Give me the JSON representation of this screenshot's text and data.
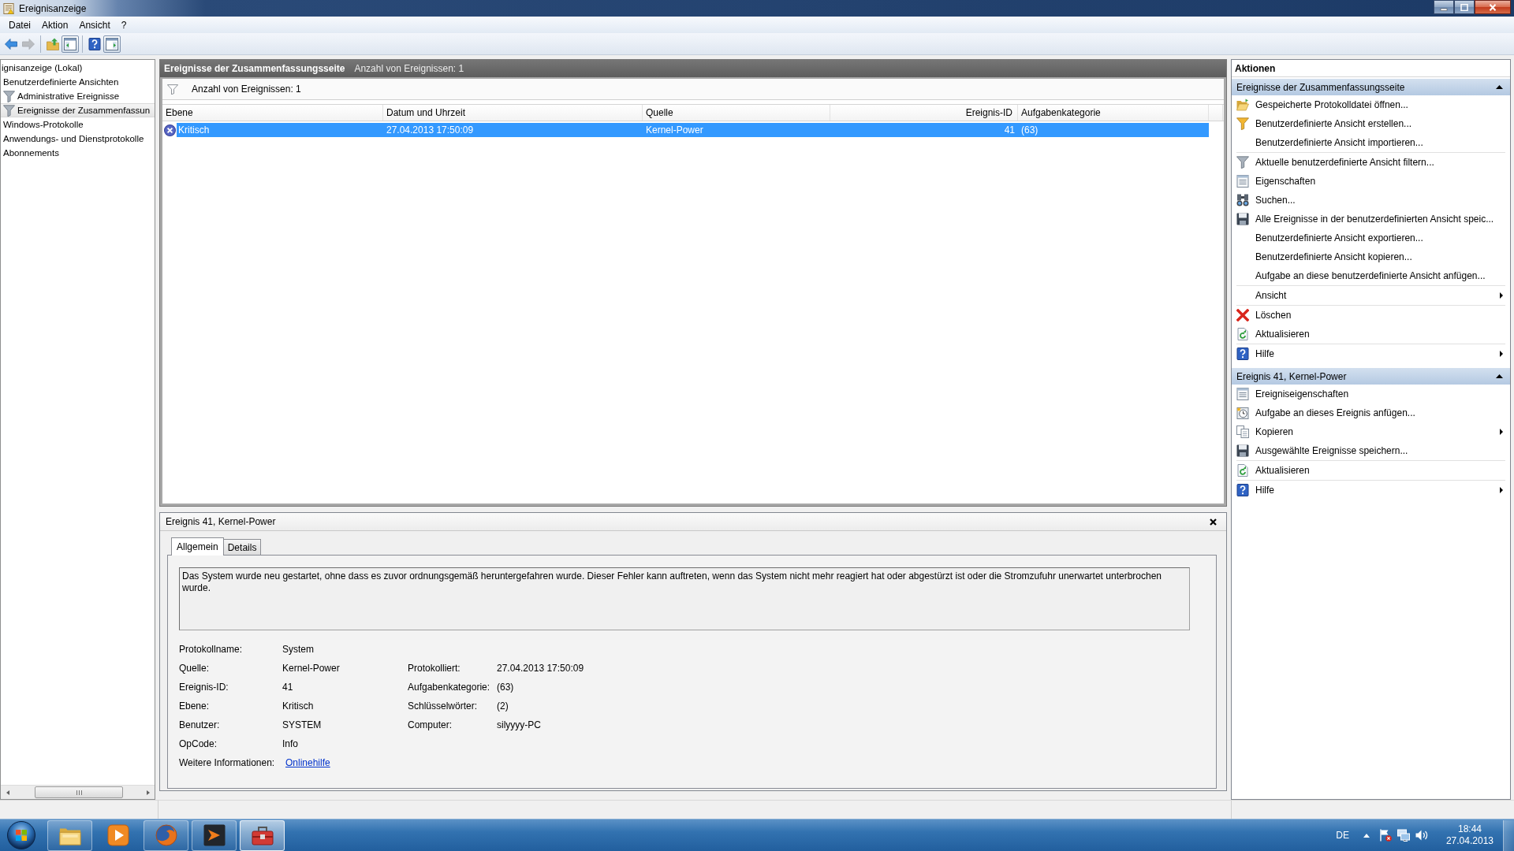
{
  "window": {
    "title": "Ereignisanzeige"
  },
  "menu": [
    "Datei",
    "Aktion",
    "Ansicht",
    "?"
  ],
  "toolbar": [
    [
      {
        "kind": "back",
        "disabled": false,
        "pressed": false
      },
      {
        "kind": "forward",
        "disabled": true,
        "pressed": false
      }
    ],
    [
      {
        "kind": "up",
        "disabled": false,
        "pressed": false
      },
      {
        "kind": "tree",
        "disabled": false,
        "pressed": true
      }
    ],
    [
      {
        "kind": "help",
        "disabled": false,
        "pressed": false
      },
      {
        "kind": "actions",
        "disabled": false,
        "pressed": true
      }
    ]
  ],
  "tree": {
    "items": [
      {
        "label": "ignisanzeige (Lokal)",
        "selected": false,
        "children": [
          {
            "label": "Benutzerdefinierte Ansichten",
            "selected": false,
            "children": [
              {
                "label": "Administrative Ereignisse",
                "selected": false
              },
              {
                "label": "Ereignisse der Zusammenfassun",
                "selected": true
              }
            ]
          },
          {
            "label": "Windows-Protokolle",
            "selected": false
          },
          {
            "label": "Anwendungs- und Dienstprotokolle",
            "selected": false
          },
          {
            "label": "Abonnements",
            "selected": false
          }
        ]
      }
    ]
  },
  "summary": {
    "title": "Ereignisse der Zusammenfassungsseite",
    "count": "Anzahl von Ereignissen: 1"
  },
  "filter_bar": {
    "text": "Anzahl von Ereignissen: 1"
  },
  "table": {
    "columns": [
      {
        "label": "Ebene",
        "kind": "text"
      },
      {
        "label": "Datum und Uhrzeit",
        "kind": "text"
      },
      {
        "label": "Quelle",
        "kind": "text"
      },
      {
        "label": "Ereignis-ID",
        "kind": "number"
      },
      {
        "label": "Aufgabenkategorie",
        "kind": "text"
      }
    ],
    "rows": [
      {
        "selected": true,
        "cells": [
          "Kritisch",
          "27.04.2013 17:50:09",
          "Kernel-Power",
          "41",
          "(63)"
        ]
      }
    ]
  },
  "detail": {
    "title": "Ereignis 41, Kernel-Power",
    "tabs": [
      {
        "label": "Allgemein",
        "selected": true
      },
      {
        "label": "Details",
        "selected": false
      }
    ],
    "description": "Das System wurde neu gestartet, ohne dass es zuvor ordnungsgemäß heruntergefahren wurde. Dieser Fehler kann auftreten, wenn das System nicht mehr reagiert hat oder abgestürzt ist oder die Stromzufuhr unerwartet unterbrochen wurde.",
    "fields": [
      [
        {
          "label": "Protokollname:",
          "value": "System"
        }
      ],
      [
        {
          "label": "Quelle:",
          "value": "Kernel-Power"
        },
        {
          "label": "Protokolliert:",
          "value": "27.04.2013 17:50:09"
        }
      ],
      [
        {
          "label": "Ereignis-ID:",
          "value": "41"
        },
        {
          "label": "Aufgabenkategorie:",
          "value": "(63)"
        }
      ],
      [
        {
          "label": "Ebene:",
          "value": "Kritisch"
        },
        {
          "label": "Schlüsselwörter:",
          "value": "(2)"
        }
      ],
      [
        {
          "label": "Benutzer:",
          "value": "SYSTEM"
        },
        {
          "label": "Computer:",
          "value": "silyyyy-PC"
        }
      ],
      [
        {
          "label": "OpCode:",
          "value": "Info"
        }
      ],
      [
        {
          "label": "Weitere Informationen:",
          "link": "Onlinehilfe"
        }
      ]
    ]
  },
  "actions": {
    "title": "Aktionen",
    "sections": [
      {
        "title": "Ereignisse der Zusammenfassungsseite",
        "expanded": true,
        "groups": [
          [
            {
              "label": "Gespeicherte Protokolldatei öffnen...",
              "kind": "open",
              "submenu": false
            },
            {
              "label": "Benutzerdefinierte Ansicht erstellen...",
              "kind": "filter-new",
              "submenu": false
            },
            {
              "label": "Benutzerdefinierte Ansicht importieren...",
              "kind": "plain",
              "submenu": false
            }
          ],
          [
            {
              "label": "Aktuelle benutzerdefinierte Ansicht filtern...",
              "kind": "filter",
              "submenu": false
            },
            {
              "label": "Eigenschaften",
              "kind": "properties",
              "submenu": false
            },
            {
              "label": "Suchen...",
              "kind": "search",
              "submenu": false
            },
            {
              "label": "Alle Ereignisse in der benutzerdefinierten Ansicht speic...",
              "kind": "save",
              "submenu": false
            },
            {
              "label": "Benutzerdefinierte Ansicht exportieren...",
              "kind": "plain",
              "submenu": false
            },
            {
              "label": "Benutzerdefinierte Ansicht kopieren...",
              "kind": "plain",
              "submenu": false
            },
            {
              "label": "Aufgabe an diese benutzerdefinierte Ansicht anfügen...",
              "kind": "plain",
              "submenu": false
            }
          ],
          [
            {
              "label": "Ansicht",
              "kind": "plain",
              "submenu": true
            }
          ],
          [
            {
              "label": "Löschen",
              "kind": "delete",
              "submenu": false
            },
            {
              "label": "Aktualisieren",
              "kind": "refresh",
              "submenu": false
            }
          ],
          [
            {
              "label": "Hilfe",
              "kind": "help",
              "submenu": true
            }
          ]
        ]
      },
      {
        "title": "Ereignis 41, Kernel-Power",
        "expanded": true,
        "groups": [
          [
            {
              "label": "Ereigniseigenschaften",
              "kind": "properties",
              "submenu": false
            },
            {
              "label": "Aufgabe an dieses Ereignis anfügen...",
              "kind": "task",
              "submenu": false
            },
            {
              "label": "Kopieren",
              "kind": "copy",
              "submenu": true
            },
            {
              "label": "Ausgewählte Ereignisse speichern...",
              "kind": "save",
              "submenu": false
            }
          ],
          [
            {
              "label": "Aktualisieren",
              "kind": "refresh",
              "submenu": false
            }
          ],
          [
            {
              "label": "Hilfe",
              "kind": "help",
              "submenu": true
            }
          ]
        ]
      }
    ]
  },
  "taskbar": {
    "apps": [
      {
        "kind": "folder",
        "running": true,
        "selected": false
      },
      {
        "kind": "media",
        "running": false,
        "selected": false
      },
      {
        "kind": "browser",
        "running": true,
        "selected": false
      },
      {
        "kind": "chevron",
        "running": true,
        "selected": false
      },
      {
        "kind": "toolbox",
        "running": true,
        "selected": true
      }
    ],
    "language": "DE",
    "time": "18:44",
    "date": "27.04.2013"
  }
}
